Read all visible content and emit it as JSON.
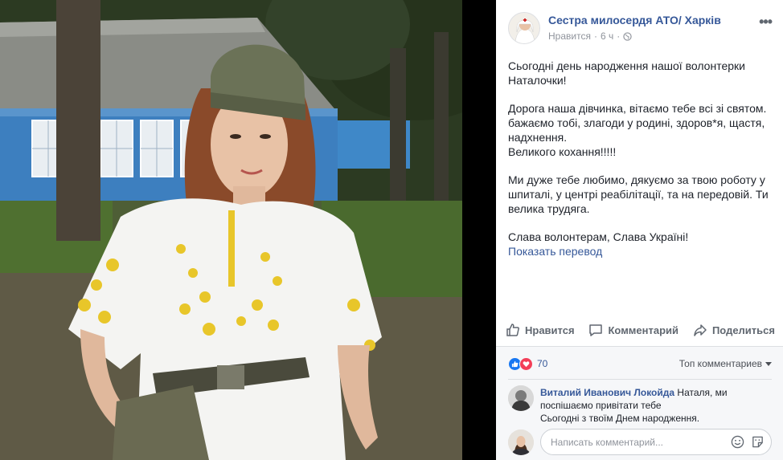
{
  "post": {
    "page_name": "Сестра милосердя АТО/ Харків",
    "like_label": "Нравится",
    "separator": "·",
    "time": "6 ч",
    "privacy_icon": "globe-icon",
    "more_icon": "ellipsis-icon",
    "more_label": "•••",
    "paragraphs": [
      "Сьогодні день народження нашої волонтерки Наталочки!",
      "Дорога наша дівчинка, вітаємо тебе всі зі святом. бажаємо тобі, злагоди у родині, здоров*я, щастя, надхнення.",
      "Великого кохання!!!!!",
      "Ми дуже тебе любимо, дякуємо за твою роботу у шпиталі, у центрі реабілітації, та на передовій. Ти велика трудяга.",
      "Слава волонтерам, Слава Україні!"
    ],
    "see_translation": "Показать перевод"
  },
  "actions": {
    "like": "Нравится",
    "comment": "Комментарий",
    "share": "Поделиться"
  },
  "reactions": {
    "count": "70",
    "types": [
      "like-icon",
      "love-icon"
    ],
    "sort_label": "Топ комментариев"
  },
  "comment": {
    "author": "Виталий Иванович Локойда",
    "line1": "Наталя, ми поспішаємо привітати тебе",
    "line2": "Сьогодні з твоїм Днем народження."
  },
  "composer": {
    "placeholder": "Написать комментарий..."
  },
  "colors": {
    "link": "#365899",
    "like": "#1877f2",
    "love": "#f33e58",
    "muted": "#90949c"
  }
}
